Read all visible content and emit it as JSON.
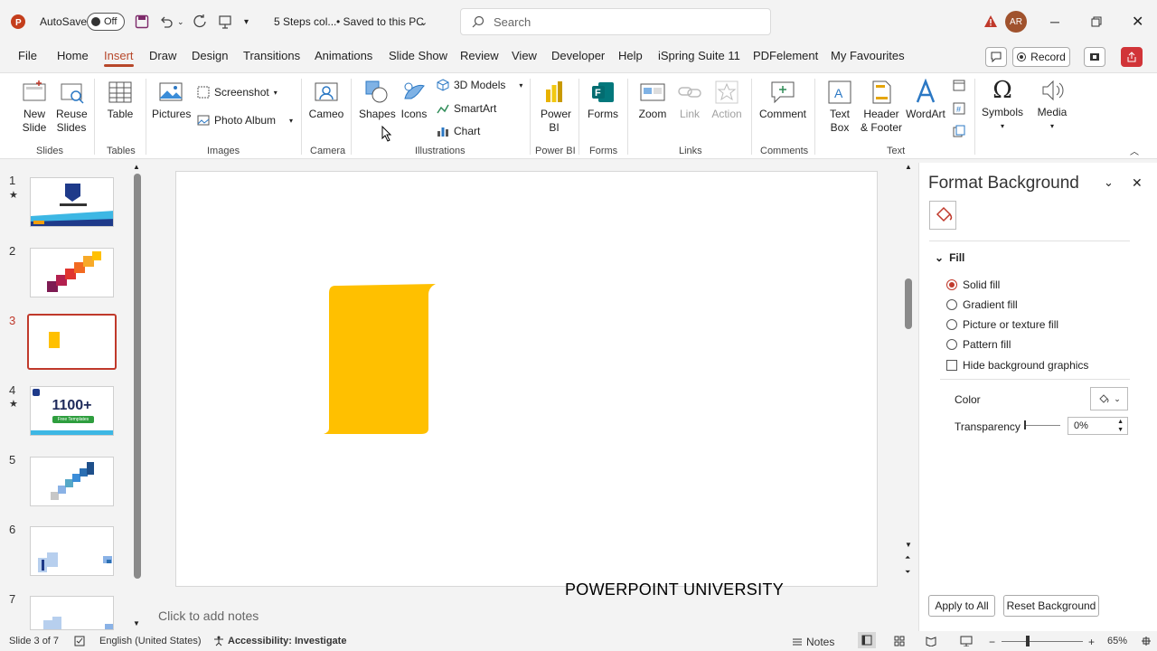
{
  "titlebar": {
    "autosave_label": "AutoSave",
    "autosave_state": "Off",
    "doc_title": "5 Steps col...",
    "save_status": "• Saved to this PC",
    "search_placeholder": "Search",
    "user_initials": "AR"
  },
  "menu": {
    "tabs": [
      "File",
      "Home",
      "Insert",
      "Draw",
      "Design",
      "Transitions",
      "Animations",
      "Slide Show",
      "Review",
      "View",
      "Developer",
      "Help",
      "iSpring Suite 11",
      "PDFelement",
      "My Favourites"
    ],
    "active_tab": "Insert",
    "record_label": "Record"
  },
  "ribbon": {
    "new_slide": "New Slide",
    "reuse_slides": "Reuse Slides",
    "table": "Table",
    "pictures": "Pictures",
    "screenshot": "Screenshot",
    "photo_album": "Photo Album",
    "cameo": "Cameo",
    "shapes": "Shapes",
    "icons": "Icons",
    "models_3d": "3D Models",
    "smartart": "SmartArt",
    "chart": "Chart",
    "power_bi": "Power BI",
    "forms": "Forms",
    "zoom": "Zoom",
    "link": "Link",
    "action": "Action",
    "comment": "Comment",
    "text_box": "Text Box",
    "header_footer": "Header & Footer",
    "wordart": "WordArt",
    "symbols": "Symbols",
    "media": "Media",
    "groups": {
      "slides": "Slides",
      "tables": "Tables",
      "images": "Images",
      "camera": "Camera",
      "illustrations": "Illustrations",
      "power_bi": "Power BI",
      "forms": "Forms",
      "links": "Links",
      "comments": "Comments",
      "text": "Text"
    }
  },
  "thumbnails": {
    "numbers": [
      "1",
      "2",
      "3",
      "4",
      "5",
      "6",
      "7"
    ],
    "star": "★",
    "slide4_big": "1100+",
    "slide4_small": "Free Templates",
    "active_index": 3
  },
  "slide": {
    "watermark": "POWERPOINT UNIVERSITY",
    "shape_color": "#FFC000"
  },
  "notes": {
    "placeholder": "Click to add notes"
  },
  "format_pane": {
    "title": "Format Background",
    "section": "Fill",
    "options": [
      "Solid fill",
      "Gradient fill",
      "Picture or texture fill",
      "Pattern fill"
    ],
    "selected": "Solid fill",
    "hide_graphics": "Hide background graphics",
    "color_label": "Color",
    "transparency_label": "Transparency",
    "transparency_value": "0%",
    "apply_all": "Apply to All",
    "reset": "Reset Background"
  },
  "status": {
    "slide_info": "Slide 3 of 7",
    "language": "English (United States)",
    "accessibility": "Accessibility: Investigate",
    "notes": "Notes",
    "zoom": "65%"
  },
  "colors": {
    "accent": "#B7472A",
    "selection": "#C0392B",
    "shape": "#FFC000"
  }
}
